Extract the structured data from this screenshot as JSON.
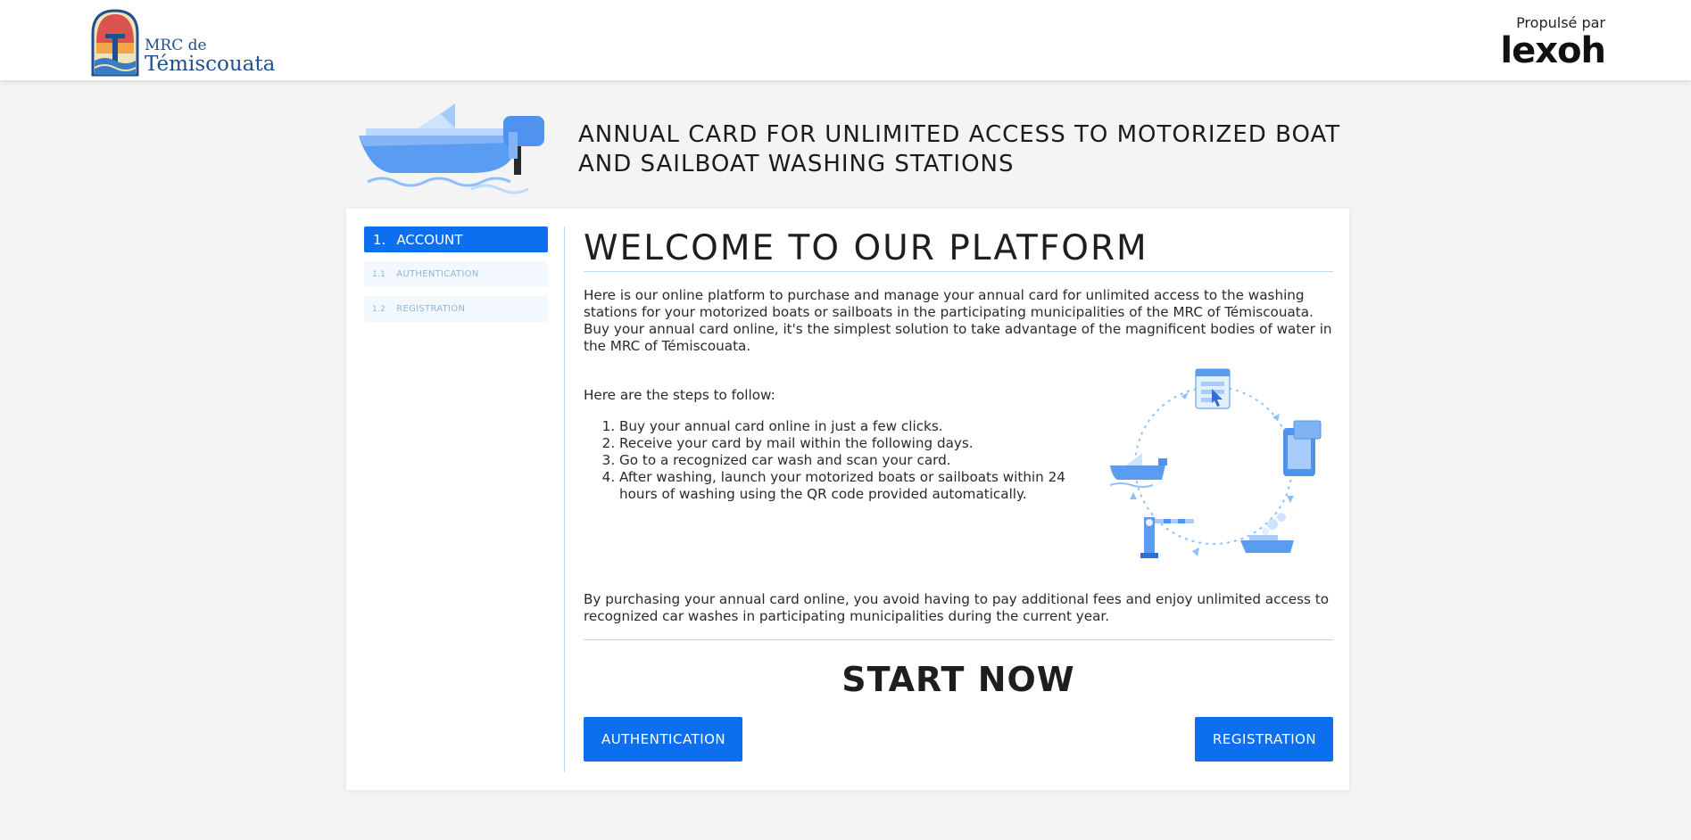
{
  "header": {
    "brand_line1": "MRC de",
    "brand_line2": "Témiscouata",
    "powered_by": "Propulsé par",
    "powered_logo": "lexoh"
  },
  "hero": {
    "title_line1": "ANNUAL CARD FOR UNLIMITED ACCESS TO MOTORIZED BOAT",
    "title_line2": "AND SAILBOAT WASHING STATIONS",
    "icon": "motorboat-illustration"
  },
  "sidebar": {
    "items": [
      {
        "num": "1.",
        "label": "ACCOUNT",
        "active": true
      },
      {
        "num": "1.1",
        "label": "AUTHENTICATION",
        "active": false
      },
      {
        "num": "1.2",
        "label": "REGISTRATION",
        "active": false
      }
    ]
  },
  "main": {
    "welcome": "WELCOME TO OUR PLATFORM",
    "intro_p1": "Here is our online platform to purchase and manage your annual card for unlimited access to the washing stations for your motorized boats or sailboats in the participating municipalities of the MRC of Témiscouata.",
    "intro_p2": "Buy your annual card online, it's the simplest solution to take advantage of the magnificent bodies of water in the MRC of Témiscouata.",
    "steps_title": "Here are the steps to follow:",
    "steps": [
      "Buy your annual card online in just a few clicks.",
      "Receive your card by mail within the following days.",
      "Go to a recognized car wash and scan your card.",
      "After washing, launch your motorized boats or sailboats within 24 hours of washing using the QR code provided automatically."
    ],
    "outro": "By purchasing your annual card online, you avoid having to pay additional fees and enjoy unlimited access to recognized car washes in participating municipalities during the current year.",
    "start_now": "START NOW",
    "btn_auth": "AUTHENTICATION",
    "btn_reg": "REGISTRATION"
  },
  "colors": {
    "primary": "#0b6ff0",
    "sub_bg": "#f2f8fe",
    "sub_text": "#8fb6db",
    "divider": "#bcd9ee",
    "brand_blue": "#1f4f8f"
  }
}
